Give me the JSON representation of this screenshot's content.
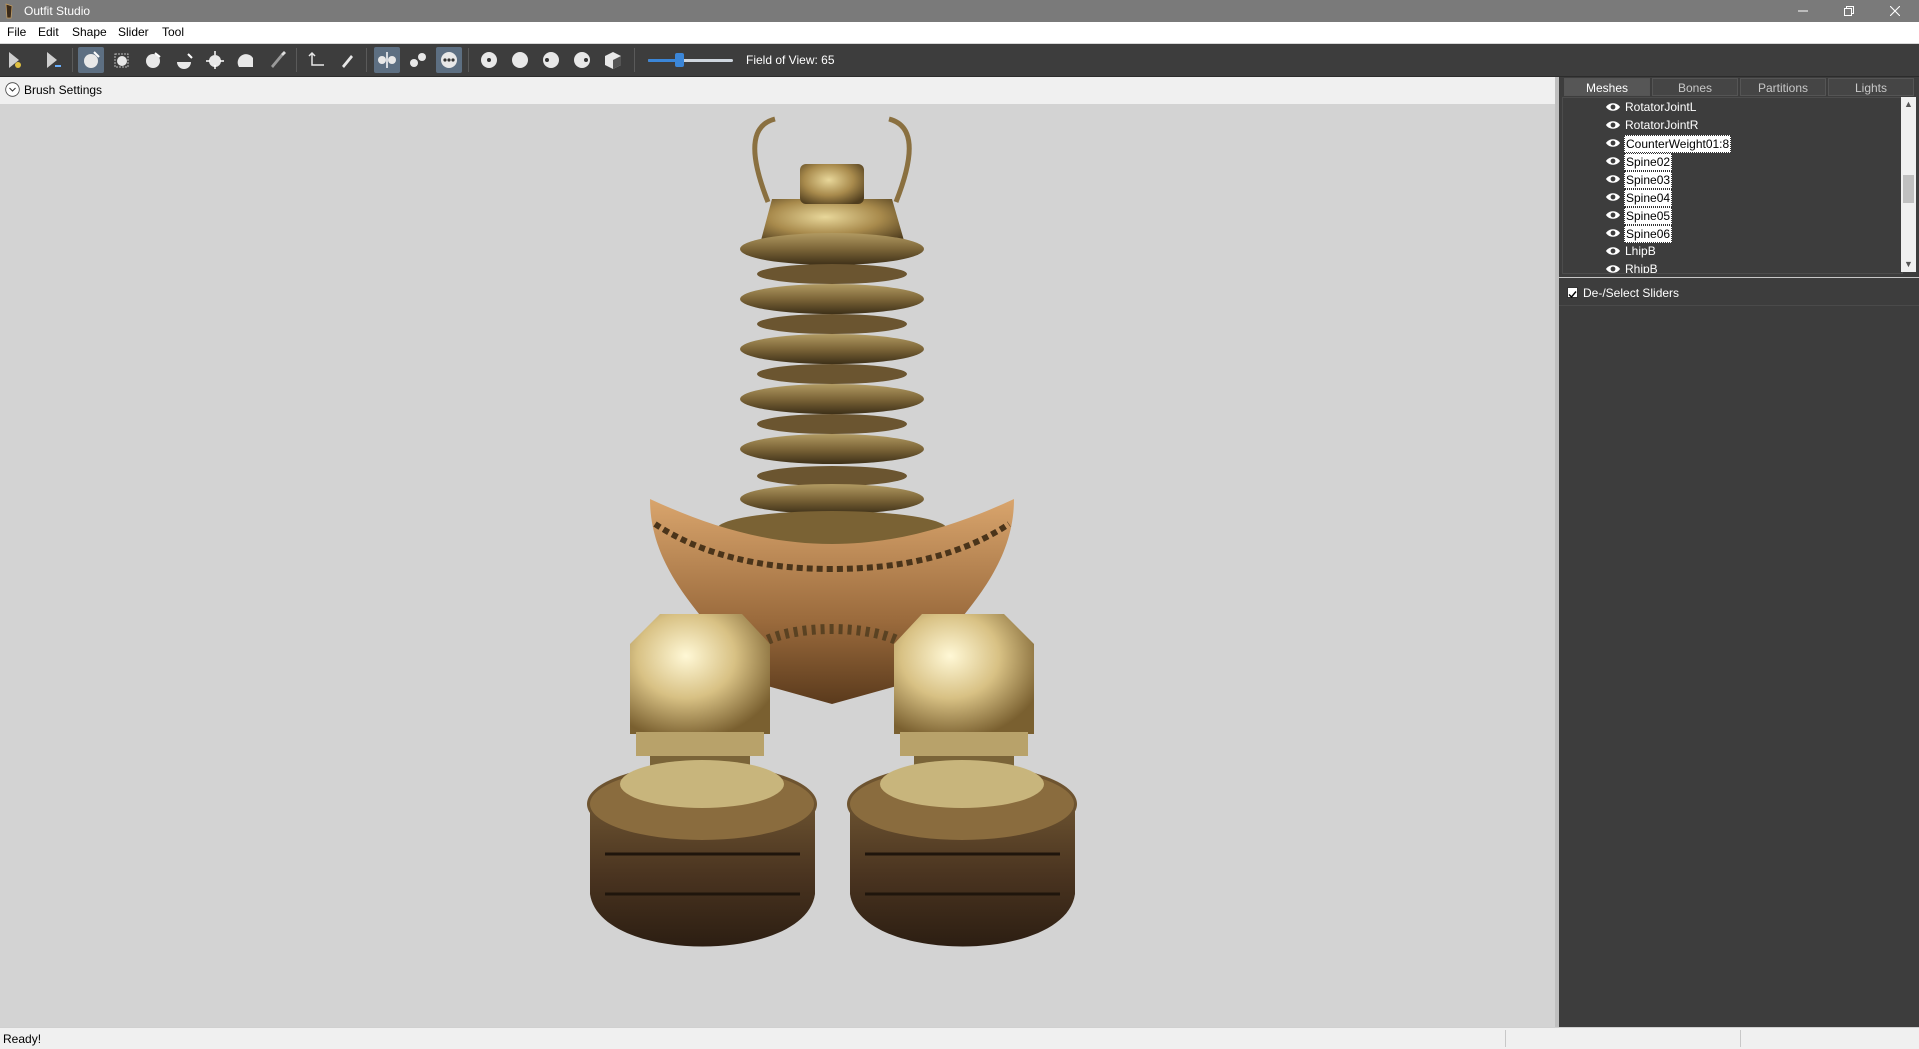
{
  "window": {
    "title": "Outfit Studio",
    "minimize_icon": "minimize-icon",
    "maximize_icon": "restore-icon",
    "close_icon": "close-icon"
  },
  "menu": [
    "File",
    "Edit",
    "Shape",
    "Slider",
    "Tool"
  ],
  "toolbar": {
    "buttons": [
      {
        "icon": "select-icon",
        "active": false
      },
      {
        "icon": "transform-icon",
        "active": false
      },
      {
        "icon": "mask-brush-icon",
        "active": true
      },
      {
        "icon": "inflate-brush-icon",
        "active": false
      },
      {
        "icon": "deflate-brush-icon",
        "active": false
      },
      {
        "icon": "move-brush-icon",
        "active": false
      },
      {
        "icon": "smooth-brush-icon",
        "active": false
      },
      {
        "icon": "weight-brush-icon",
        "active": false
      },
      {
        "icon": "color-brush-icon",
        "active": false
      },
      {
        "icon": "pivot-icon",
        "active": false
      },
      {
        "icon": "pen-icon",
        "active": false
      },
      {
        "icon": "mirror-x-icon",
        "active": true
      },
      {
        "icon": "connected-only-icon",
        "active": false
      },
      {
        "icon": "global-brush-icon",
        "active": true
      },
      {
        "icon": "front-view-icon",
        "active": false
      },
      {
        "icon": "back-view-icon",
        "active": false
      },
      {
        "icon": "left-view-icon",
        "active": false
      },
      {
        "icon": "right-view-icon",
        "active": false
      },
      {
        "icon": "perspective-cube-icon",
        "active": false
      }
    ],
    "fov_label": "Field of View: 65",
    "fov_fraction": 0.37
  },
  "viewport": {
    "brush_settings_label": "Brush Settings",
    "background_color": "#d3d3d3"
  },
  "panel": {
    "tabs": [
      {
        "label": "Meshes",
        "active": true
      },
      {
        "label": "Bones",
        "active": false
      },
      {
        "label": "Partitions",
        "active": false
      },
      {
        "label": "Lights",
        "active": false
      }
    ],
    "tree": [
      {
        "label": "RotatorJointL",
        "selected": false
      },
      {
        "label": "RotatorJointR",
        "selected": false
      },
      {
        "label": "CounterWeight01:8",
        "selected": true
      },
      {
        "label": "Spine02",
        "selected": true
      },
      {
        "label": "Spine03",
        "selected": true
      },
      {
        "label": "Spine04",
        "selected": true
      },
      {
        "label": "Spine05",
        "selected": true
      },
      {
        "label": "Spine06",
        "selected": true
      },
      {
        "label": "LhipB",
        "selected": false
      },
      {
        "label": "RhipB",
        "selected": false
      }
    ],
    "deselect_sliders_label": "De-/Select Sliders",
    "deselect_checked": true
  },
  "status": {
    "text": "Ready!"
  }
}
